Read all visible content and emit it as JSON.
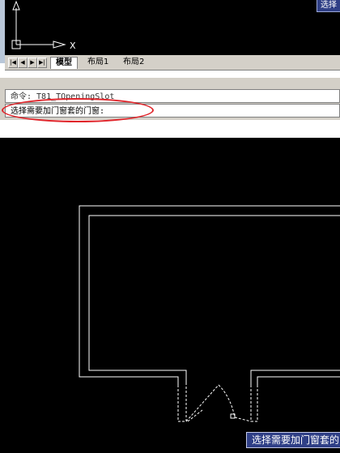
{
  "top_viewport": {
    "tooltip": "选择",
    "axis_label": "X"
  },
  "tabs": [
    {
      "label": "模型",
      "active": true
    },
    {
      "label": "布局1",
      "active": false
    },
    {
      "label": "布局2",
      "active": false
    }
  ],
  "nav_buttons": [
    "|◀",
    "◀",
    "▶",
    "▶|"
  ],
  "command_line": {
    "history": "命令: T81_TOpeningSlot",
    "prompt": "选择需要加门窗套的门窗:"
  },
  "bottom_viewport": {
    "tooltip": "选择需要加门窗套的门窗"
  },
  "colors": {
    "canvas": "#000000",
    "drawing_lines": "#ffffff",
    "tooltip_bg": "#2f3f86",
    "highlight_oval": "#e0242a",
    "toolbar_bg": "#d4d0c8"
  }
}
